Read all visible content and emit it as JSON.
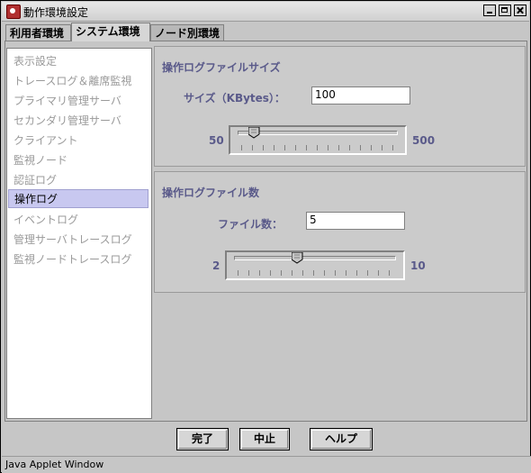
{
  "window": {
    "title": "動作環境設定",
    "status": "Java Applet Window"
  },
  "tabs": [
    {
      "label": "利用者環境"
    },
    {
      "label": "システム環境"
    },
    {
      "label": "ノード別環境"
    }
  ],
  "sidebar": {
    "items": [
      {
        "label": "表示設定"
      },
      {
        "label": "トレースログ＆離席監視"
      },
      {
        "label": "プライマリ管理サーバ"
      },
      {
        "label": "セカンダリ管理サーバ"
      },
      {
        "label": "クライアント"
      },
      {
        "label": "監視ノード"
      },
      {
        "label": "認証ログ"
      },
      {
        "label": "操作ログ"
      },
      {
        "label": "イベントログ"
      },
      {
        "label": "管理サーバトレースログ"
      },
      {
        "label": "監視ノードトレースログ"
      }
    ],
    "selected": "操作ログ"
  },
  "log_size": {
    "title": "操作ログファイルサイズ",
    "label": "サイズ（KBytes）：",
    "value": "100",
    "min_label": "50",
    "max_label": "500",
    "slider_fraction": 0.05
  },
  "log_count": {
    "title": "操作ログファイル数",
    "label": "ファイル数：",
    "value": "5",
    "min_label": "2",
    "max_label": "10",
    "slider_fraction": 0.375
  },
  "buttons": {
    "ok": "完了",
    "cancel": "中止",
    "help": "ヘルプ"
  }
}
